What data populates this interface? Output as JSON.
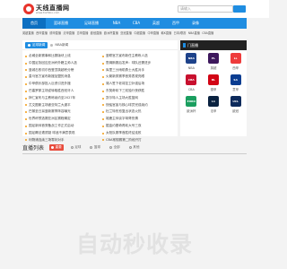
{
  "header": {
    "logo_title": "天线直播网",
    "logo_subtitle": "www.txzhibo.com",
    "search_placeholder": "请输入",
    "colors": {
      "brand_blue": "#1f8de1",
      "brand_red": "#e8342b"
    }
  },
  "nav": {
    "items": [
      {
        "label": "首页",
        "active": true
      },
      {
        "label": "篮球直播",
        "active": false
      },
      {
        "label": "足球直播",
        "active": false
      },
      {
        "label": "NBA",
        "active": false
      },
      {
        "label": "CBA",
        "active": false
      },
      {
        "label": "英超",
        "active": false
      },
      {
        "label": "西甲",
        "active": false
      },
      {
        "label": "录像",
        "active": false
      }
    ]
  },
  "subnav": [
    "英超直播",
    "西甲直播",
    "德甲直播",
    "法甲直播",
    "意甲直播",
    "欧冠直播",
    "欧洲杯直播",
    "亚冠直播",
    "中超直播",
    "中甲直播",
    "韩K直播",
    "日本J联赛",
    "NBA直播",
    "CBA直播"
  ],
  "main": {
    "tabs": [
      {
        "label": "足球新闻",
        "active": true
      },
      {
        "label": "NBA新闻",
        "active": false
      }
    ],
    "news_left": [
      "必威全新赛事和比赛版块上线",
      "中国足协回应亚洲杯外籍主帅人选",
      "曼城击败切尔西登顶英超积分榜",
      "皇马官方宣布新援加盟的消息",
      "中甲俱乐部投入巨资引进外援",
      "巴塞罗那主场逆转取胜西班牙人",
      "拜仁宣布与主教练续约至2027年",
      "尤文图斯主场被亚特兰大逼平",
      "巴黎圣日耳曼新赛季阵容曝光",
      "世界杯预选赛亚洲区赛程确定",
      "国足新帅首秀备战工作正式启动",
      "国足踢法遭质疑 球迷不满意表现",
      "利物浦连续三场零封对手"
    ],
    "news_right": [
      "曼联官方宣布新任主教练人选",
      "詹姆斯赛后发声：球队还需进步",
      "库里三分雨助勇士大胜对手",
      "火箭新秀赛季首秀表现亮眼",
      "湖人签下老将控卫补强后场",
      "东契奇砍下三双独行侠获胜",
      "凯尔特人主场大胜篮网",
      "快船官宣与核心球员完成续约",
      "杜兰特伤愈复出状态火热",
      "雄鹿主帅谈字母哥伤情",
      "掘金约基奇再砍大号三双",
      "太阳队赛季首胜终结连败",
      "CBA常规赛第二阶段开打"
    ]
  },
  "side": {
    "title": "门直播",
    "leagues": [
      {
        "name": "NBA",
        "icon": "nba-logo",
        "abbr": "NBA",
        "color": "#1d428a"
      },
      {
        "name": "英超",
        "icon": "premier-league-logo",
        "abbr": "PL",
        "color": "#3d185c"
      },
      {
        "name": "西甲",
        "icon": "laliga-logo",
        "abbr": "LL",
        "color": "#ee3b3b"
      },
      {
        "name": "CBA",
        "icon": "cba-logo",
        "abbr": "CBA",
        "color": "#c8102e"
      },
      {
        "name": "德甲",
        "icon": "bundesliga-logo",
        "abbr": "BL",
        "color": "#d20515"
      },
      {
        "name": "意甲",
        "icon": "serie-a-logo",
        "abbr": "SA",
        "color": "#0b3d91"
      },
      {
        "name": "欧洲杯",
        "icon": "euro-logo",
        "abbr": "EURO",
        "color": "#1a9e5f"
      },
      {
        "name": "法甲",
        "icon": "ligue1-logo",
        "abbr": "L1",
        "color": "#0a2240"
      },
      {
        "name": "欧冠",
        "icon": "champions-league-logo",
        "abbr": "UCL",
        "color": "#0c2a5b"
      }
    ]
  },
  "schedule": {
    "title": "直播列表",
    "filters": [
      {
        "label": "重要",
        "active": true
      },
      {
        "label": "足球",
        "active": false
      },
      {
        "label": "篮球",
        "active": false
      },
      {
        "label": "全部",
        "active": false
      },
      {
        "label": "其他",
        "active": false
      }
    ]
  },
  "watermark": "自动秒收录"
}
